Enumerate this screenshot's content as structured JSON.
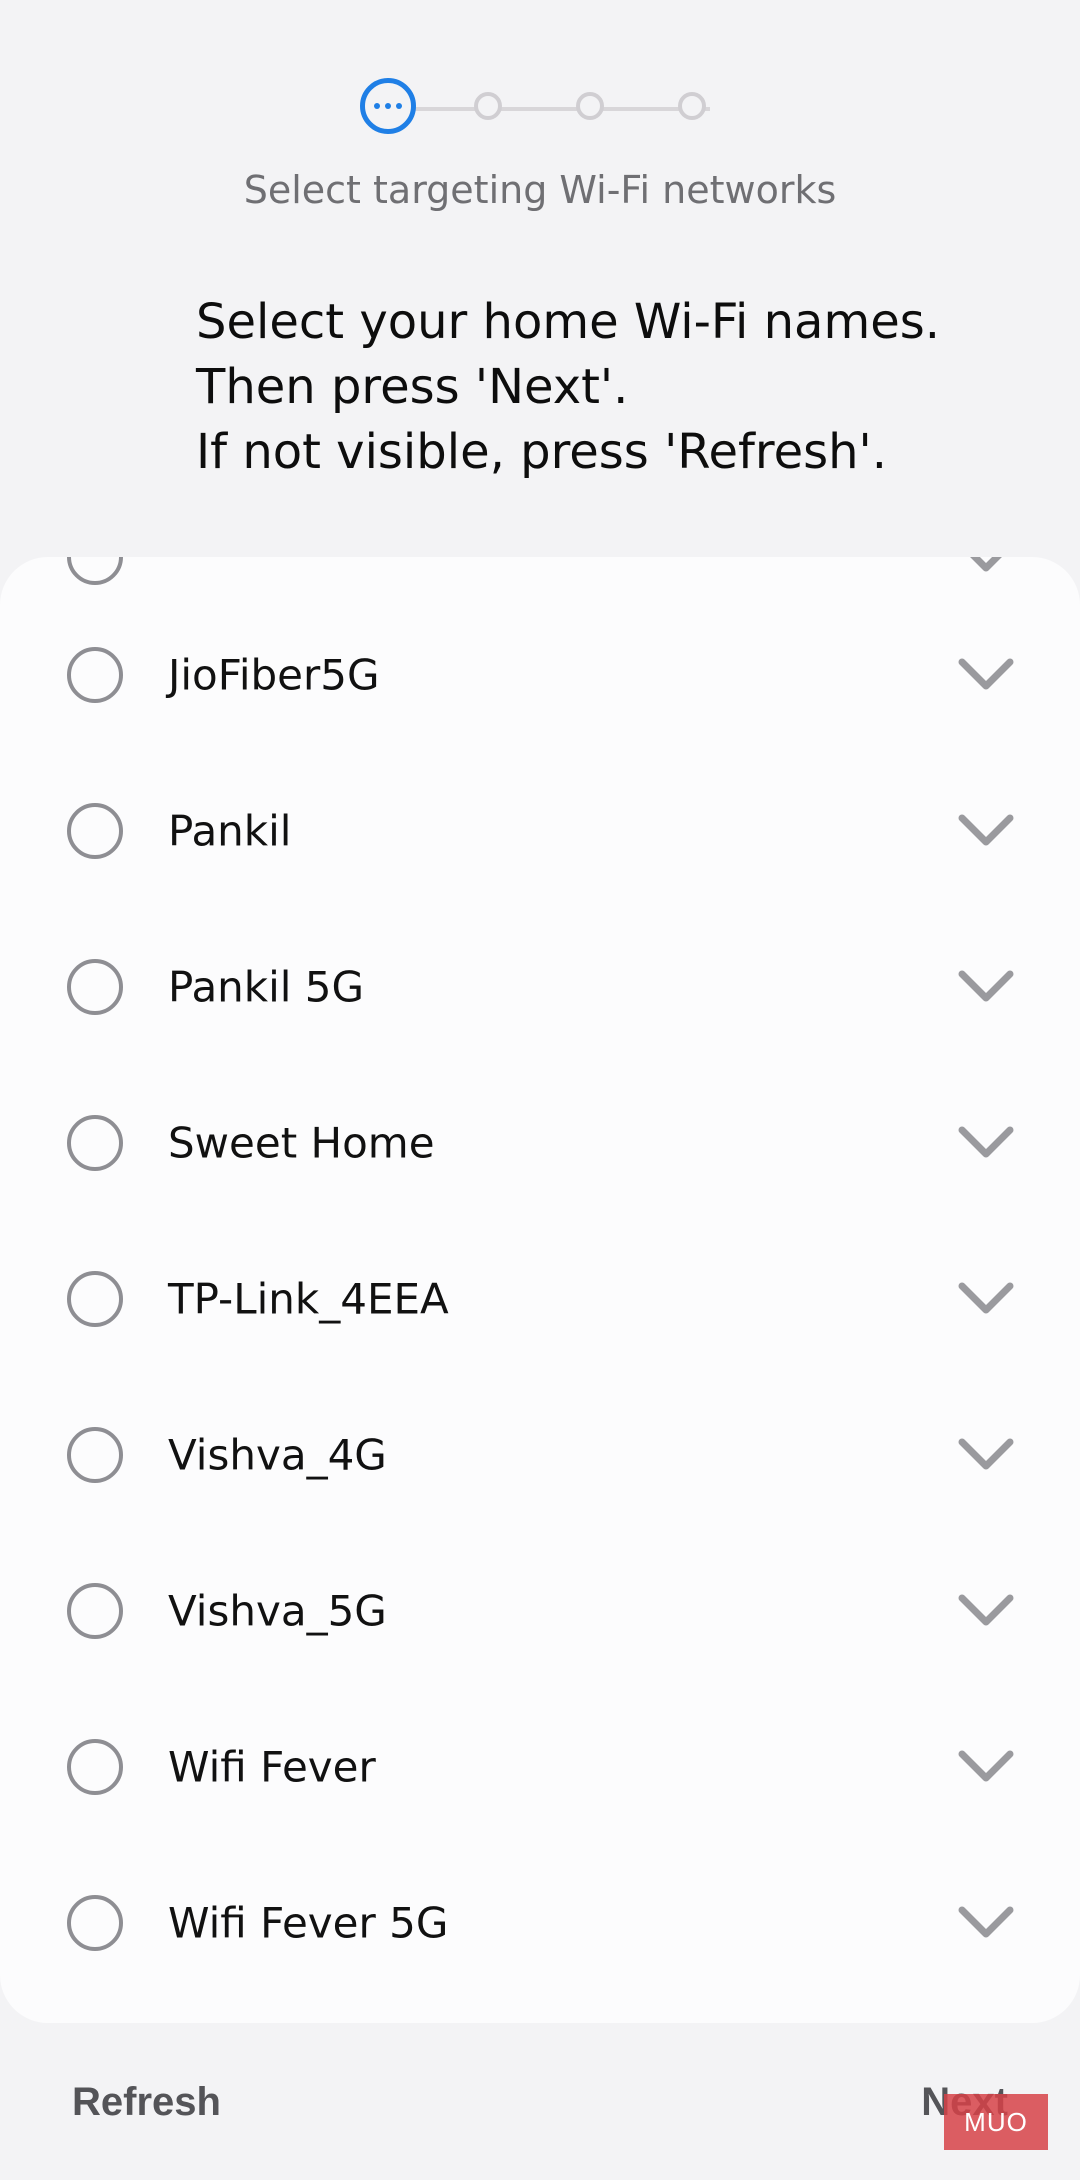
{
  "header": {
    "step_title": "Select targeting Wi-Fi networks",
    "instructions": [
      "Select your home Wi-Fi names.",
      "Then press 'Next'.",
      "If not visible, press 'Refresh'."
    ]
  },
  "stepper": {
    "total_steps": 4,
    "current_step": 1,
    "accent_color": "#1f7fe6"
  },
  "networks": [
    {
      "name": "JioFiber5G",
      "selected": false
    },
    {
      "name": "Pankil",
      "selected": false
    },
    {
      "name": "Pankil 5G",
      "selected": false
    },
    {
      "name": "Sweet Home",
      "selected": false
    },
    {
      "name": "TP-Link_4EEA",
      "selected": false
    },
    {
      "name": "Vishva_4G",
      "selected": false
    },
    {
      "name": "Vishva_5G",
      "selected": false
    },
    {
      "name": "Wifi Fever",
      "selected": false
    },
    {
      "name": "Wifi Fever 5G",
      "selected": false
    }
  ],
  "footer": {
    "refresh_label": "Refresh",
    "next_label": "Next"
  },
  "watermark": {
    "text": "MUO"
  }
}
